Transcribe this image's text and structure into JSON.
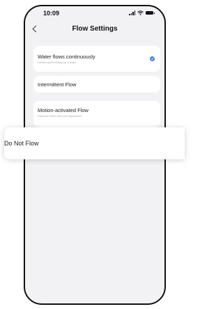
{
  "status_bar": {
    "time": "10:09"
  },
  "navbar": {
    "title": "Flow Settings"
  },
  "options": [
    {
      "label": "Water flows continuously",
      "subtitle": "Uninterrupted welling up of water",
      "selected": true
    },
    {
      "label": "Intermittent Flow",
      "subtitle": "",
      "selected": false
    },
    {
      "label": "Motion-activated Flow",
      "subtitle": "Dispense water when pet approaches",
      "selected": false
    }
  ],
  "popup": {
    "label": "Do Not Flow"
  },
  "colors": {
    "accent": "#3d7be6",
    "background": "#f2f2f4",
    "card": "#ffffff"
  },
  "icons": [
    "back-chevron-icon",
    "signal-icon",
    "wifi-icon",
    "battery-icon",
    "checkmark-icon"
  ]
}
